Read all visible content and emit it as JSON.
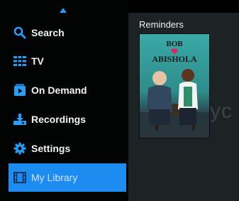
{
  "sidebar": {
    "items": [
      {
        "label": "Search",
        "icon": "search-icon"
      },
      {
        "label": "TV",
        "icon": "tv-guide-icon"
      },
      {
        "label": "On Demand",
        "icon": "on-demand-icon"
      },
      {
        "label": "Recordings",
        "icon": "recordings-icon"
      },
      {
        "label": "Settings",
        "icon": "gear-icon"
      },
      {
        "label": "My Library",
        "icon": "film-icon",
        "selected": true
      }
    ]
  },
  "main": {
    "section_title": "Reminders",
    "poster": {
      "title_line1": "BOB",
      "title_line2": "ABISHOLA"
    },
    "ghost_text": "yc"
  },
  "colors": {
    "accent": "#1c8cf0",
    "arrow": "#2b9cf5",
    "panel": "#1d2225",
    "heart": "#e0245e"
  }
}
